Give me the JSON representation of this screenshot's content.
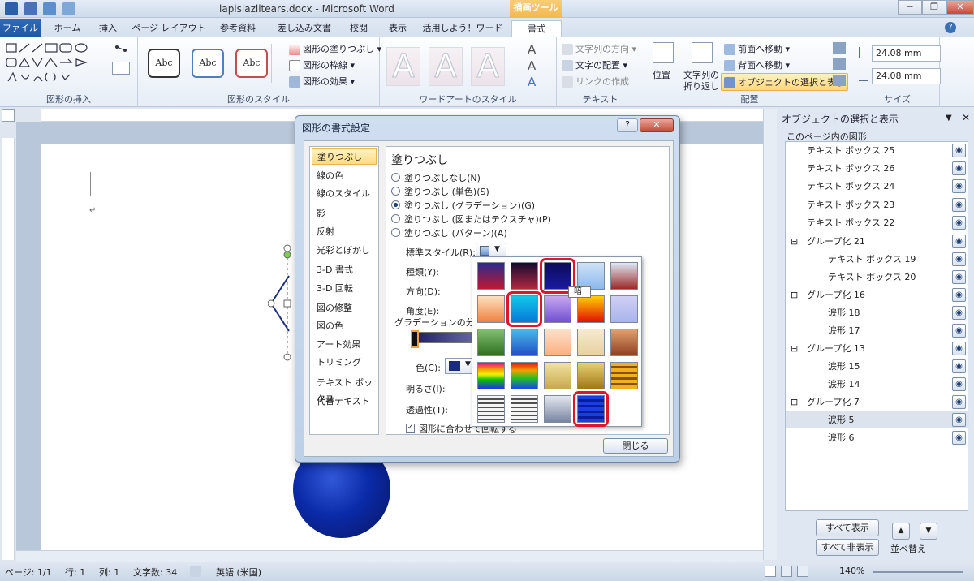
{
  "window": {
    "title": "lapislazlitears.docx - Microsoft Word",
    "context_tab": "描画ツール",
    "minimize": "─",
    "restore": "❐",
    "close": "✕"
  },
  "tabs": [
    "ファイル",
    "ホーム",
    "挿入",
    "ページ レイアウト",
    "参考資料",
    "差し込み文書",
    "校閲",
    "表示",
    "活用しよう！ワード",
    "書式"
  ],
  "ribbon": {
    "insert_shapes_label": "図形の挿入",
    "shape_styles_label": "図形のスタイル",
    "abc": "Abc",
    "shape_fill": "図形の塗りつぶし",
    "shape_outline": "図形の枠線",
    "shape_effects": "図形の効果",
    "wordart_label": "ワードアートのスタイル",
    "wordart_letter": "A",
    "text_label": "テキスト",
    "text_direction": "文字列の方向",
    "text_align": "文字の配置",
    "create_link": "リンクの作成",
    "arrange_label": "配置",
    "position": "位置",
    "wrap1": "文字列の",
    "wrap2": "折り返し",
    "bring_forward": "前面へ移動",
    "send_backward": "背面へ移動",
    "selection_pane": "オブジェクトの選択と表示",
    "size_label": "サイズ",
    "height": "24.08 mm",
    "width": "24.08 mm"
  },
  "dialog": {
    "title": "図形の書式設定",
    "nav": [
      "塗りつぶし",
      "線の色",
      "線のスタイル",
      "影",
      "反射",
      "光彩とぼかし",
      "3-D 書式",
      "3-D 回転",
      "図の修整",
      "図の色",
      "アート効果",
      "トリミング",
      "テキスト ボックス",
      "代替テキスト"
    ],
    "section_title": "塗りつぶし",
    "options": [
      "塗りつぶしなし(N)",
      "塗りつぶし (単色)(S)",
      "塗りつぶし (グラデーション)(G)",
      "塗りつぶし (図またはテクスチャ)(P)",
      "塗りつぶし (パターン)(A)"
    ],
    "selected_option": "塗りつぶし (グラデーション)(G)",
    "preset_label": "標準スタイル(R):",
    "type_label": "種類(Y):",
    "direction_label": "方向(D):",
    "angle_label": "角度(E):",
    "stops_label": "グラデーションの分岐",
    "color_label": "色(C):",
    "brightness_label": "明るさ(I):",
    "transparency_label": "透過性(T):",
    "rotate_with_shape": "図形に合わせて回転する",
    "close_button": "閉じる",
    "tooltip": "暗"
  },
  "palette_colors": [
    [
      "#2a2a8c",
      "#c01830"
    ],
    [
      "#160a30",
      "#b02840"
    ],
    [
      "#0c0c5a",
      "#1a1aa0"
    ],
    [
      "#cfe2f7",
      "#8db8ec"
    ],
    [
      "#dde8f4",
      "#9c2a28"
    ],
    [
      "#fde0c0",
      "#f08040"
    ],
    [
      "#10c8e8",
      "#0878d8"
    ],
    [
      "#c8a8f0",
      "#7050d0"
    ],
    [
      "#ffd000",
      "#e01000"
    ],
    [
      "#d0d0f4",
      "#a8b4ec"
    ],
    [
      "#80c070",
      "#2e7020"
    ],
    [
      "#4ab8e8",
      "#2050c8"
    ],
    [
      "#fde0c8",
      "#fab080"
    ],
    [
      "#f6ead0",
      "#e8d0a0"
    ],
    [
      "#e0a070",
      "#904020"
    ],
    [
      "#f000a0",
      "#2030f0"
    ],
    [
      "#f01010",
      "#2040f0"
    ],
    [
      "#f2e2a0",
      "#c8a850"
    ],
    [
      "#e8d070",
      "#a07818"
    ],
    [
      "#f0b020",
      "#a06008"
    ],
    [
      "#d8d8d8",
      "#404040"
    ],
    [
      "#f0f0f0",
      "#383838"
    ],
    [
      "#e4e8ef",
      "#7884a0"
    ],
    [
      "#1840e0",
      "#0814a0"
    ]
  ],
  "selection_pane": {
    "title": "オブジェクトの選択と表示",
    "header": "このページ内の図形",
    "items": [
      {
        "label": "テキスト ボックス 25",
        "level": 0
      },
      {
        "label": "テキスト ボックス 26",
        "level": 0
      },
      {
        "label": "テキスト ボックス 24",
        "level": 0
      },
      {
        "label": "テキスト ボックス 23",
        "level": 0
      },
      {
        "label": "テキスト ボックス 22",
        "level": 0
      },
      {
        "label": "グループ化 21",
        "level": 0,
        "group": true
      },
      {
        "label": "テキスト ボックス 19",
        "level": 1
      },
      {
        "label": "テキスト ボックス 20",
        "level": 1
      },
      {
        "label": "グループ化 16",
        "level": 0,
        "group": true
      },
      {
        "label": "涙形 18",
        "level": 1
      },
      {
        "label": "涙形 17",
        "level": 1
      },
      {
        "label": "グループ化 13",
        "level": 0,
        "group": true
      },
      {
        "label": "涙形 15",
        "level": 1
      },
      {
        "label": "涙形 14",
        "level": 1
      },
      {
        "label": "グループ化 7",
        "level": 0,
        "group": true
      },
      {
        "label": "涙形 5",
        "level": 1,
        "selected": true
      },
      {
        "label": "涙形 6",
        "level": 1
      }
    ],
    "show_all": "すべて表示",
    "hide_all": "すべて非表示",
    "reorder": "並べ替え"
  },
  "status": {
    "page": "ページ: 1/1",
    "line": "行: 1",
    "column": "列: 1",
    "chars": "文字数: 34",
    "language": "英語 (米国)",
    "zoom": "140%"
  }
}
